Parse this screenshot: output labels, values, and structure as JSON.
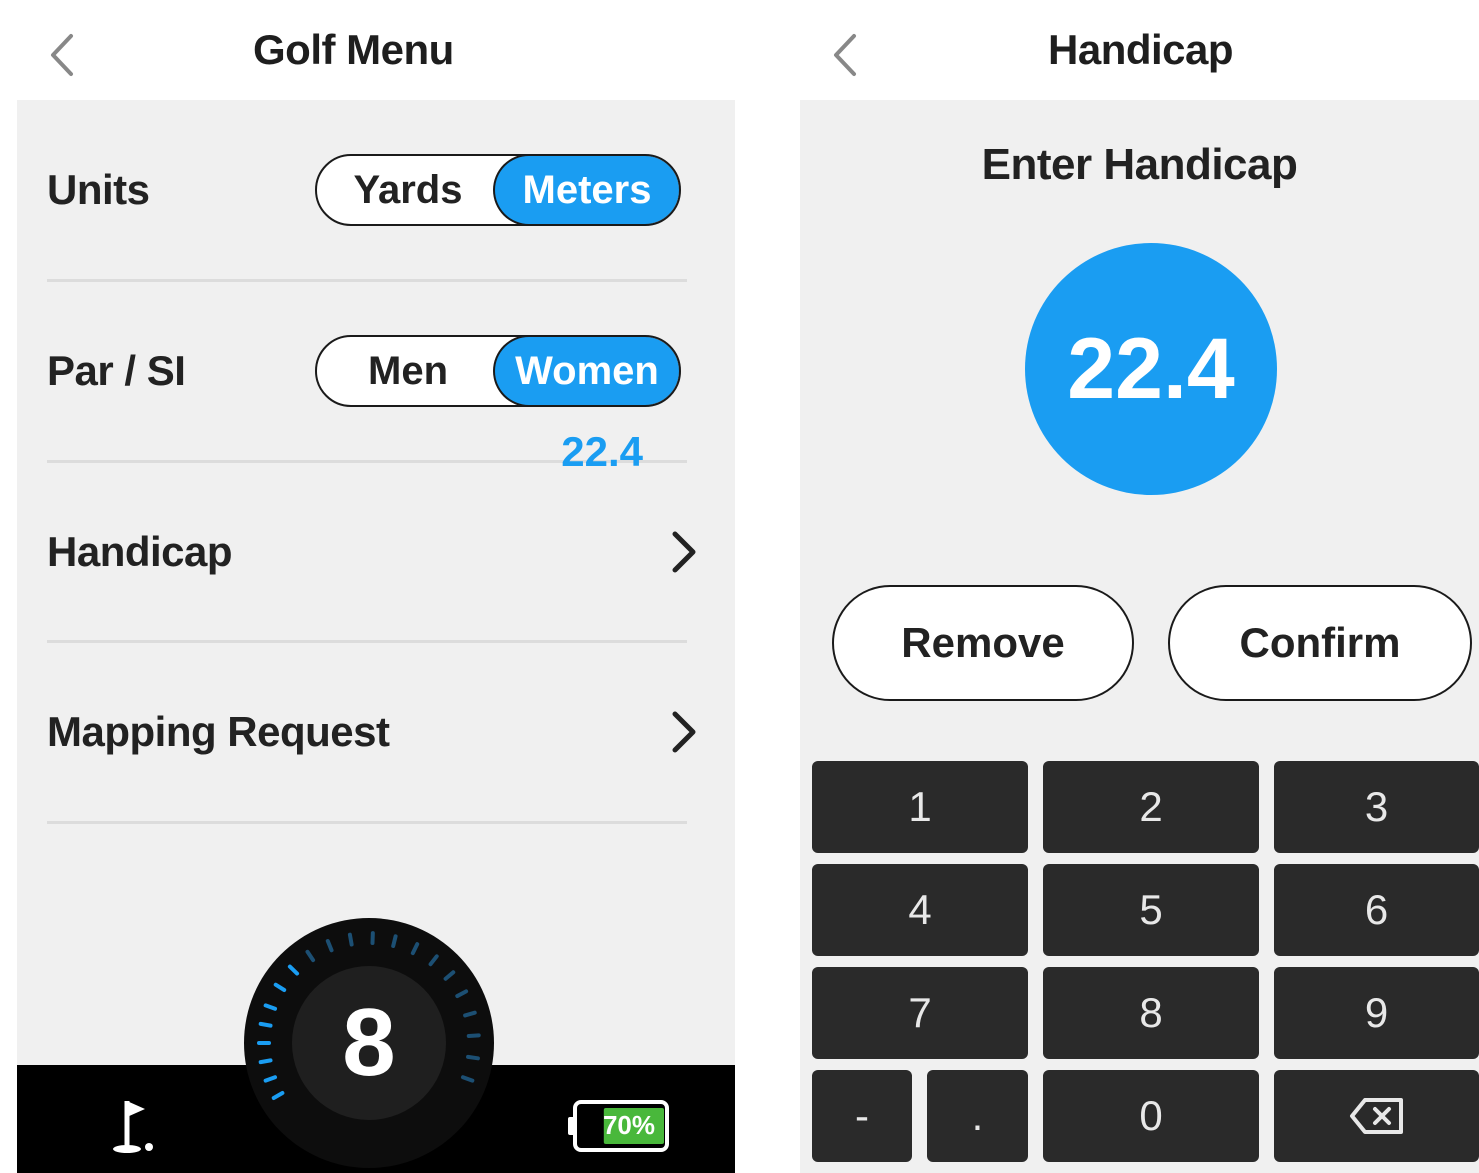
{
  "left_screen": {
    "title": "Golf Menu",
    "units": {
      "label": "Units",
      "options": [
        "Yards",
        "Meters"
      ],
      "selected": "Meters"
    },
    "par_si": {
      "label": "Par / SI",
      "options": [
        "Men",
        "Women"
      ],
      "selected": "Women"
    },
    "handicap": {
      "label": "Handicap",
      "value": "22.4"
    },
    "mapping": {
      "label": "Mapping Request"
    },
    "dial": {
      "number": "8"
    },
    "battery": {
      "percent": "70%",
      "level": 0.7
    },
    "icons": {
      "back": "chevron-left-icon",
      "flag": "golf-flag-icon",
      "battery": "battery-icon"
    },
    "colors": {
      "accent": "#1a9df2",
      "battery_fill": "#49b83b"
    }
  },
  "right_screen": {
    "title": "Handicap",
    "prompt": "Enter Handicap",
    "value": "22.4",
    "remove_label": "Remove",
    "confirm_label": "Confirm",
    "keypad": {
      "row1": [
        "1",
        "2",
        "3"
      ],
      "row2": [
        "4",
        "5",
        "6"
      ],
      "row3": [
        "7",
        "8",
        "9"
      ],
      "row4": [
        "-",
        ".",
        "0"
      ]
    },
    "icons": {
      "back": "chevron-left-icon",
      "delete": "backspace-icon"
    }
  }
}
